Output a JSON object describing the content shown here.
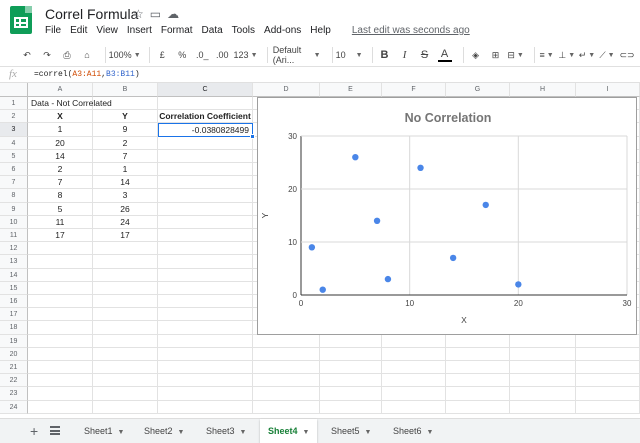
{
  "app": {
    "title": "Correl Formula",
    "menus": [
      "File",
      "Edit",
      "View",
      "Insert",
      "Format",
      "Data",
      "Tools",
      "Add-ons",
      "Help"
    ],
    "last_edit": "Last edit was seconds ago"
  },
  "toolbar": {
    "zoom": "100%",
    "currency": "£",
    "percent": "%",
    "decimal_less": ".0_",
    "decimal_more": ".00",
    "number_format": "123",
    "font": "Default (Ari...",
    "font_size": "10",
    "bold": "B",
    "italic": "I",
    "strike": "S",
    "text_color": "A"
  },
  "formula_bar": {
    "fx": "fx",
    "prefix": "=correl(",
    "range1": "A3:A11",
    "sep": ",",
    "range2": "B3:B11",
    "suffix": ")"
  },
  "columns": [
    "A",
    "B",
    "C",
    "D",
    "E",
    "F",
    "G",
    "H",
    "I"
  ],
  "rows": [
    "1",
    "2",
    "3",
    "4",
    "5",
    "6",
    "7",
    "8",
    "9",
    "10",
    "11",
    "12",
    "13",
    "14",
    "15",
    "16",
    "17",
    "18",
    "19",
    "20",
    "21",
    "22",
    "23",
    "24"
  ],
  "cells": {
    "a1": "Data - Not Correlated",
    "a2": "X",
    "b2": "Y",
    "c2": "Correlation Coefficient",
    "c3": "-0.0380828499",
    "x": [
      "1",
      "20",
      "14",
      "2",
      "7",
      "8",
      "5",
      "11",
      "17"
    ],
    "y": [
      "9",
      "2",
      "7",
      "1",
      "14",
      "3",
      "26",
      "24",
      "17"
    ]
  },
  "chart_data": {
    "type": "scatter",
    "title": "No Correlation",
    "xlabel": "X",
    "ylabel": "Y",
    "x": [
      1,
      20,
      14,
      2,
      7,
      8,
      5,
      11,
      17
    ],
    "y": [
      9,
      2,
      7,
      1,
      14,
      3,
      26,
      24,
      17
    ],
    "xlim": [
      0,
      30
    ],
    "ylim": [
      0,
      30
    ],
    "xticks": [
      "0",
      "10",
      "20",
      "30"
    ],
    "yticks": [
      "0",
      "10",
      "20",
      "30"
    ],
    "grid": true,
    "legend": "none",
    "point_color": "#4a86e8"
  },
  "sheets": {
    "tabs": [
      "Sheet1",
      "Sheet2",
      "Sheet3",
      "Sheet4",
      "Sheet5",
      "Sheet6"
    ],
    "active": "Sheet4"
  },
  "colors": {
    "accent": "#1a73e8",
    "active_sheet": "#188038",
    "brand": "#0f9d58"
  }
}
